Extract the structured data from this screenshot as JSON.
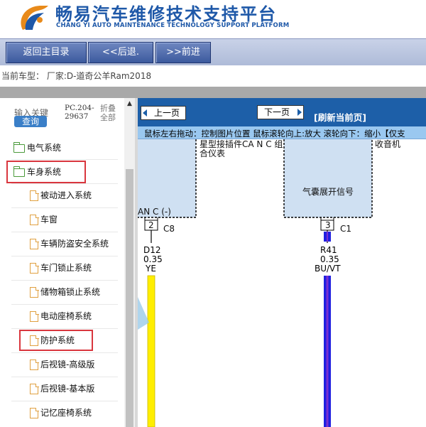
{
  "header": {
    "brand_cn": "畅易汽车维修技术支持平台",
    "brand_en": "CHANG YI AUTO MAINTENANCE TECHNOLOGY SUPPORT PLATFORM",
    "accent": "#1e58a8"
  },
  "nav": {
    "home_label": "返回主目录",
    "back_label": "<<后退.",
    "forward_label": ">>前进"
  },
  "vehicle": {
    "label": "当前车型： 厂家:D-道奇公羊Ram2018"
  },
  "sidebar": {
    "search_label": "输入关键",
    "search_button": "查询",
    "pc_code": "PC.204-29637",
    "fold_label": "折叠全部",
    "items": [
      {
        "label": "电气系统",
        "icon": "folder-icon",
        "level": 0
      },
      {
        "label": "车身系统",
        "icon": "folder-open-icon",
        "level": 0,
        "highlighted": true
      },
      {
        "label": "被动进入系统",
        "icon": "page-icon",
        "level": 1
      },
      {
        "label": "车窗",
        "icon": "page-icon",
        "level": 1
      },
      {
        "label": "车辆防盗安全系统",
        "icon": "page-icon",
        "level": 1
      },
      {
        "label": "车门锁止系统",
        "icon": "page-icon",
        "level": 1
      },
      {
        "label": "储物箱锁止系统",
        "icon": "page-icon",
        "level": 1
      },
      {
        "label": "电动座椅系统",
        "icon": "page-icon",
        "level": 1
      },
      {
        "label": "防护系统",
        "icon": "page-icon",
        "level": 1,
        "highlighted": true
      },
      {
        "label": "后视镜-高级版",
        "icon": "page-icon",
        "level": 1
      },
      {
        "label": "后视镜-基本版",
        "icon": "page-icon",
        "level": 1
      },
      {
        "label": "记忆座椅系统",
        "icon": "page-icon",
        "level": 1
      }
    ]
  },
  "diagram": {
    "prev_label": "上一页",
    "next_label": "下一页",
    "refresh_label": "[刷新当前页]",
    "hint": "鼠标左右拖动：控制图片位置 鼠标滚轮向上:放大  滚轮向下：缩小【仅支",
    "left_box_title": "星型接插件CA N C 组合仪表",
    "left_box_pin_label": "AN C (-)",
    "left_pin": "2",
    "left_connector": "C8",
    "left_wire_code": "D12",
    "left_wire_gauge": "0.35",
    "left_wire_color": "YE",
    "right_box_top": "收音机",
    "right_box_label": "气囊展开信号",
    "right_pin": "3",
    "right_connector": "C1",
    "right_wire_code": "R41",
    "right_wire_gauge": "0.35",
    "right_wire_color": "BU/VT",
    "colors": {
      "wire_yellow": "#ffee00",
      "wire_blue": "#2020e0",
      "wire_violet": "#7a30d0",
      "box_fill": "#cfe0f2",
      "toolbar": "#1d5fa8"
    }
  }
}
